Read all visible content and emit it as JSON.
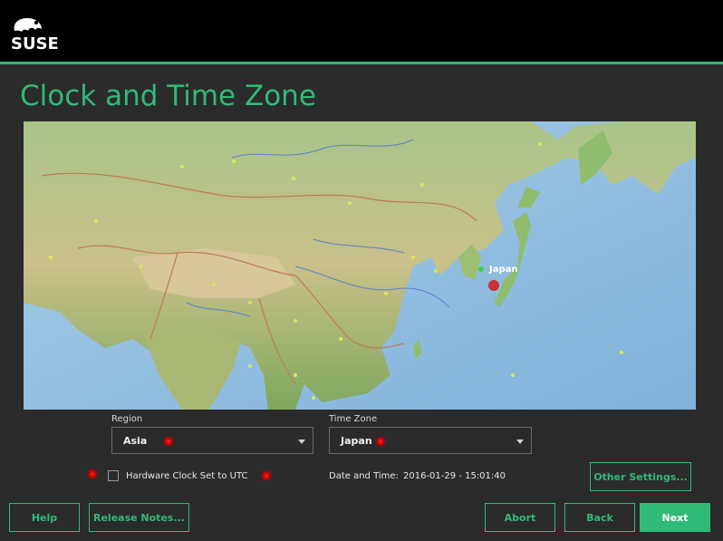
{
  "header": {
    "logo_text": "SUSE"
  },
  "page": {
    "title": "Clock and Time Zone"
  },
  "map": {
    "selected_label": "Japan"
  },
  "region": {
    "label": "Region",
    "value": "Asia"
  },
  "timezone": {
    "label": "Time Zone",
    "value": "Japan"
  },
  "hwclock": {
    "label": "Hardware Clock Set to UTC",
    "checked": false
  },
  "datetime": {
    "label": "Date and Time:",
    "value": "2016-01-29 - 15:01:40"
  },
  "buttons": {
    "other_settings": "Other Settings...",
    "help": "Help",
    "release_notes": "Release Notes...",
    "abort": "Abort",
    "back": "Back",
    "next": "Next"
  },
  "colors": {
    "accent": "#30ba78",
    "background": "#2b2b2b",
    "header": "#000000",
    "error_dot": "#e00000"
  }
}
